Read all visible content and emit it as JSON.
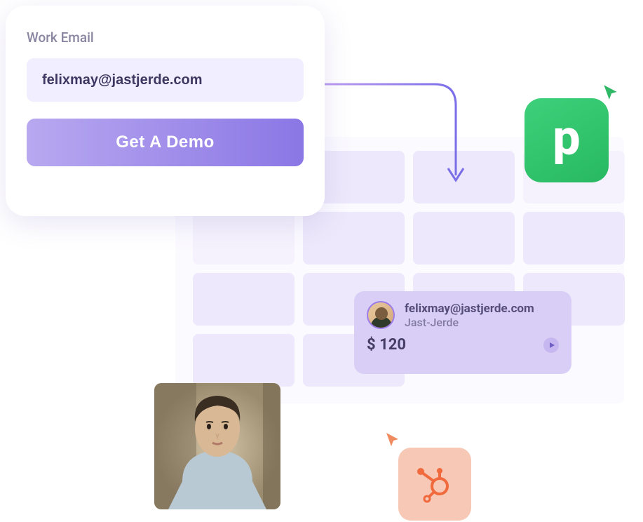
{
  "form": {
    "label": "Work Email",
    "email_value": "felixmay@jastjerde.com",
    "cta_label": "Get A Demo"
  },
  "contact": {
    "email": "felixmay@jastjerde.com",
    "company": "Jast-Jerde",
    "amount": "$ 120"
  },
  "integrations": {
    "pipedrive": {
      "letter": "p",
      "color": "#28b862"
    },
    "hubspot": {
      "color": "#f06a3e"
    }
  },
  "colors": {
    "accent": "#8b77e5",
    "card_bg": "#d9cff6",
    "field_bg": "#f1efff"
  }
}
